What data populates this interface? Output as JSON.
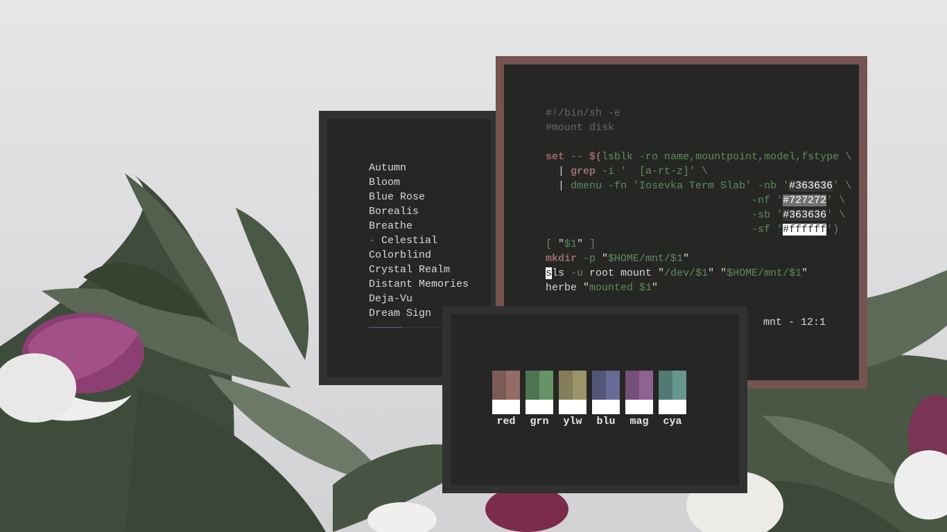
{
  "list_window": {
    "items": [
      {
        "label": "Autumn",
        "marker": ""
      },
      {
        "label": "Bloom",
        "marker": ""
      },
      {
        "label": "Blue Rose",
        "marker": ""
      },
      {
        "label": "Borealis",
        "marker": ""
      },
      {
        "label": "Breathe",
        "marker": ""
      },
      {
        "label": "Celestial",
        "marker": "- "
      },
      {
        "label": "Colorblind",
        "marker": ""
      },
      {
        "label": "Crystal Realm",
        "marker": ""
      },
      {
        "label": "Distant Memories",
        "marker": ""
      },
      {
        "label": "Deja-Vu",
        "marker": ""
      },
      {
        "label": "Dream Sign",
        "marker": ""
      }
    ],
    "scroll_progress": 0.44
  },
  "terminal": {
    "lines": [
      [
        {
          "t": "#!/bin/sh -e",
          "c": "c-comment"
        }
      ],
      [
        {
          "t": "#mount disk",
          "c": "c-comment"
        }
      ],
      [],
      [
        {
          "t": "set",
          "c": "c-kw"
        },
        {
          "t": " -- ",
          "c": "c-op"
        },
        {
          "t": "$(",
          "c": "c-kw"
        },
        {
          "t": "lsblk -ro name,mountpoint,model,fstype \\",
          "c": "c-str"
        }
      ],
      [
        {
          "t": "  | ",
          "c": "c-plain"
        },
        {
          "t": "grep",
          "c": "c-kw"
        },
        {
          "t": " -i '  [a-rt-z]' \\",
          "c": "c-str"
        }
      ],
      [
        {
          "t": "  | ",
          "c": "c-plain"
        },
        {
          "t": "dmenu -fn 'Iosevka Term Slab' -nb '",
          "c": "c-str"
        },
        {
          "t": "#363636",
          "c": "c-hl1"
        },
        {
          "t": "' \\",
          "c": "c-str"
        }
      ],
      [
        {
          "t": "                                 -nf '",
          "c": "c-str"
        },
        {
          "t": "#727272",
          "c": "c-hl2"
        },
        {
          "t": "' \\",
          "c": "c-str"
        }
      ],
      [
        {
          "t": "                                 -sb '",
          "c": "c-str"
        },
        {
          "t": "#363636",
          "c": "c-hl1"
        },
        {
          "t": "' \\",
          "c": "c-str"
        }
      ],
      [
        {
          "t": "                                 -sf '",
          "c": "c-str"
        },
        {
          "t": "#ffffff",
          "c": "c-hl3"
        },
        {
          "t": "')",
          "c": "c-op"
        }
      ],
      [
        {
          "t": "[ ",
          "c": "c-op"
        },
        {
          "t": "\"",
          "c": "c-plain"
        },
        {
          "t": "$1",
          "c": "c-str"
        },
        {
          "t": "\"",
          "c": "c-plain"
        },
        {
          "t": " ]",
          "c": "c-op"
        }
      ],
      [
        {
          "t": "mkdir",
          "c": "c-kw"
        },
        {
          "t": " -p ",
          "c": "c-str"
        },
        {
          "t": "\"",
          "c": "c-plain"
        },
        {
          "t": "$HOME/mnt/$1",
          "c": "c-str"
        },
        {
          "t": "\"",
          "c": "c-plain"
        }
      ],
      [
        {
          "t": "s",
          "c": "c-cursor"
        },
        {
          "t": "ls",
          "c": "c-plain"
        },
        {
          "t": " -u ",
          "c": "c-str"
        },
        {
          "t": "root mount ",
          "c": "c-plain"
        },
        {
          "t": "\"",
          "c": "c-plain"
        },
        {
          "t": "/dev/$1",
          "c": "c-str"
        },
        {
          "t": "\" \"",
          "c": "c-plain"
        },
        {
          "t": "$HOME/mnt/$1",
          "c": "c-str"
        },
        {
          "t": "\"",
          "c": "c-plain"
        }
      ],
      [
        {
          "t": "herbe ",
          "c": "c-plain"
        },
        {
          "t": "\"",
          "c": "c-plain"
        },
        {
          "t": "mounted $1",
          "c": "c-str"
        },
        {
          "t": "\"",
          "c": "c-plain"
        }
      ]
    ],
    "status": "mnt - 12:1"
  },
  "palette": {
    "swatches": [
      {
        "label": "red",
        "dark": "#7c5a56",
        "light": "#946b65"
      },
      {
        "label": "grn",
        "dark": "#4e7450",
        "light": "#659466"
      },
      {
        "label": "ylw",
        "dark": "#847d5a",
        "light": "#9a9468"
      },
      {
        "label": "blu",
        "dark": "#535678",
        "light": "#666b96"
      },
      {
        "label": "mag",
        "dark": "#764f78",
        "light": "#906292"
      },
      {
        "label": "cya",
        "dark": "#527a74",
        "light": "#66968d"
      }
    ]
  },
  "colors": {
    "background": "#262725",
    "border_active": "#755350",
    "border_inactive": "#303130",
    "foreground": "#d8d8d6"
  }
}
